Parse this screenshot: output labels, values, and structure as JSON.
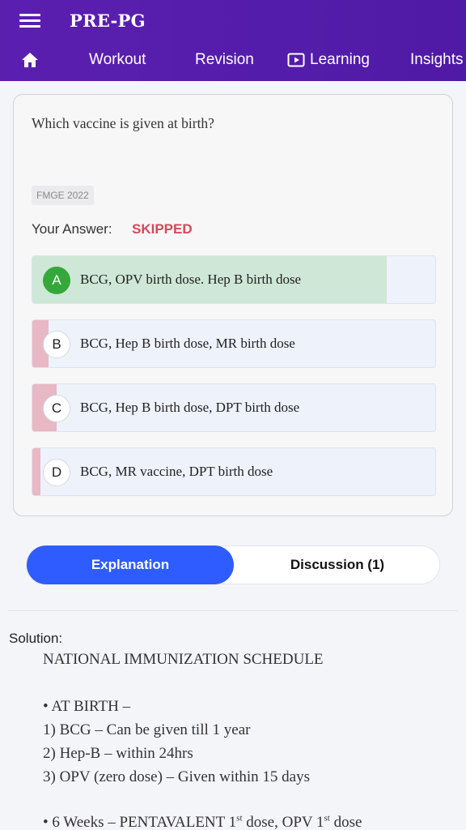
{
  "header": {
    "title": "PRE-PG",
    "nav": {
      "workout": "Workout",
      "revision": "Revision",
      "learning": "Learning",
      "insights": "Insights"
    }
  },
  "question": {
    "text": "Which vaccine is given at birth?",
    "tag": "FMGE 2022",
    "your_answer_label": "Your Answer:",
    "your_answer_value": "SKIPPED",
    "options": [
      {
        "letter": "A",
        "text": "BCG, OPV birth dose. Hep B birth dose",
        "correct": true,
        "response_fraction": 0.88
      },
      {
        "letter": "B",
        "text": "BCG, Hep B birth dose, MR birth dose",
        "correct": false,
        "response_fraction": 0.04
      },
      {
        "letter": "C",
        "text": "BCG, Hep B birth dose, DPT birth dose",
        "correct": false,
        "response_fraction": 0.06
      },
      {
        "letter": "D",
        "text": "BCG, MR vaccine, DPT birth dose",
        "correct": false,
        "response_fraction": 0.02
      }
    ]
  },
  "tabs": {
    "explanation": "Explanation",
    "discussion": "Discussion (1)"
  },
  "solution": {
    "label": "Solution:",
    "heading": "NATIONAL IMMUNIZATION SCHEDULE",
    "at_birth": "• AT BIRTH –",
    "item1": "1) BCG – Can be given till 1 year",
    "item2": "2) Hep-B – within 24hrs",
    "item3": "3) OPV (zero dose) – Given within 15 days",
    "six_weeks_a": "• 6 Weeks – PENTAVALENT 1",
    "six_weeks_sup1": "st",
    "six_weeks_b": " dose, OPV 1",
    "six_weeks_sup2": "st",
    "six_weeks_c": " dose"
  },
  "colors": {
    "header": "#5b1fb0",
    "correct_fill": "#cfe7d6",
    "wrong_fill": "#e8b8c4",
    "skipped": "#d8475b",
    "tab_active": "#2f5cff"
  }
}
